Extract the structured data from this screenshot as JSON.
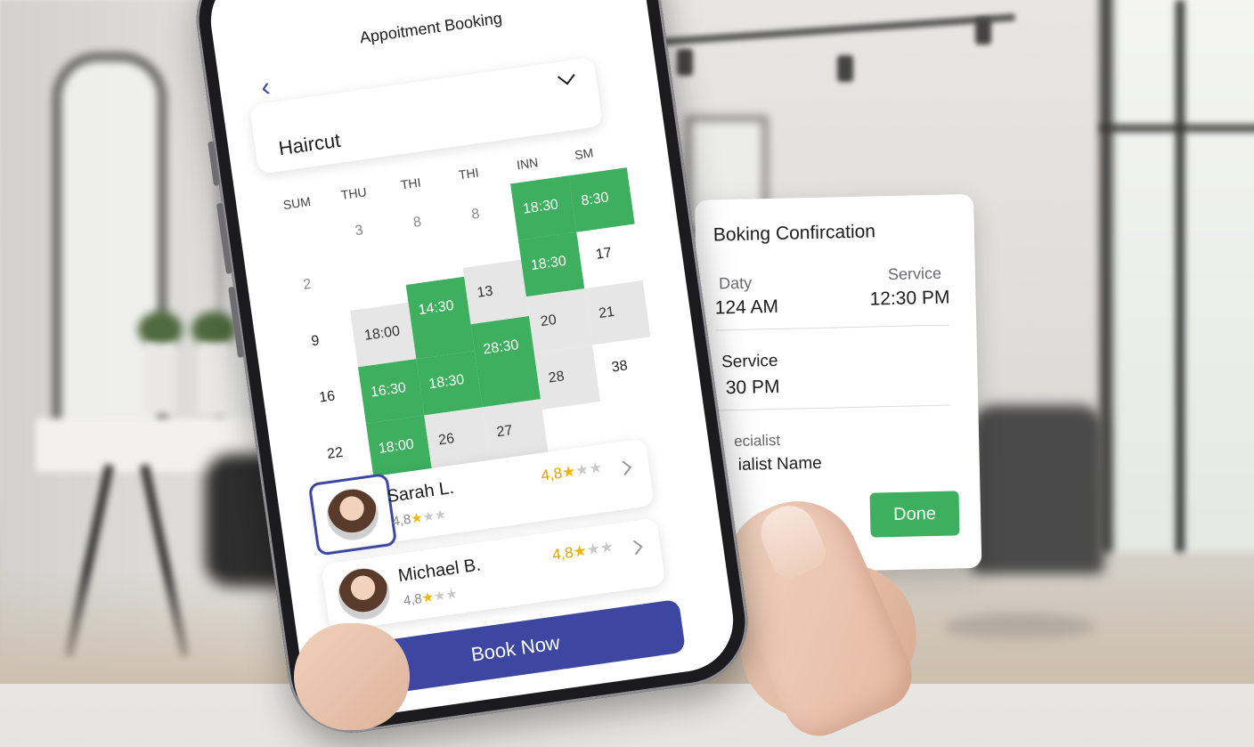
{
  "app": {
    "header_title": "Appoitment Booking",
    "service_value": "Haircut",
    "day_headers": [
      "SUM",
      "THU",
      "THI",
      "THI",
      "INN",
      "SM"
    ],
    "calendar": {
      "cells": [
        {
          "label": "3"
        },
        {
          "label": "8"
        },
        {
          "label": "8"
        },
        {
          "label": "18:30"
        },
        {
          "label": "8:30"
        },
        {
          "label": "2"
        },
        {
          "label": "17"
        },
        {
          "label": "13"
        },
        {
          "label": "18:30"
        },
        {
          "label": "9"
        },
        {
          "label": "18:00"
        },
        {
          "label": "14:30"
        },
        {
          "label": "20"
        },
        {
          "label": "21"
        },
        {
          "label": "16"
        },
        {
          "label": "16:30"
        },
        {
          "label": "18:30"
        },
        {
          "label": "28:30"
        },
        {
          "label": "28"
        },
        {
          "label": "38"
        },
        {
          "label": "22"
        },
        {
          "label": "18:00"
        },
        {
          "label": "26"
        },
        {
          "label": "27"
        }
      ]
    },
    "specialists": [
      {
        "name": "Sarah L.",
        "rating_small": "4,8",
        "rating_big": "4,8"
      },
      {
        "name": "Michael B.",
        "rating_small": "4,8",
        "rating_big": "4,8"
      }
    ],
    "book_label": "Book Now",
    "back_icon": "chevron-left-icon"
  },
  "confirmation": {
    "title": "Boking Confircation",
    "day_label": "Daty",
    "day_value": "124 AM",
    "service_label_top": "Service",
    "service_value_top": "12:30 PM",
    "service_label": "Service",
    "service_value": "30 PM",
    "specialist_label": "ecialist",
    "specialist_value": "ialist Name",
    "done_label": "Done"
  },
  "colors": {
    "accent": "#3d47a2",
    "available": "#3daf5f",
    "unavailable": "#e6e6e6",
    "rating": "#e0a400"
  }
}
